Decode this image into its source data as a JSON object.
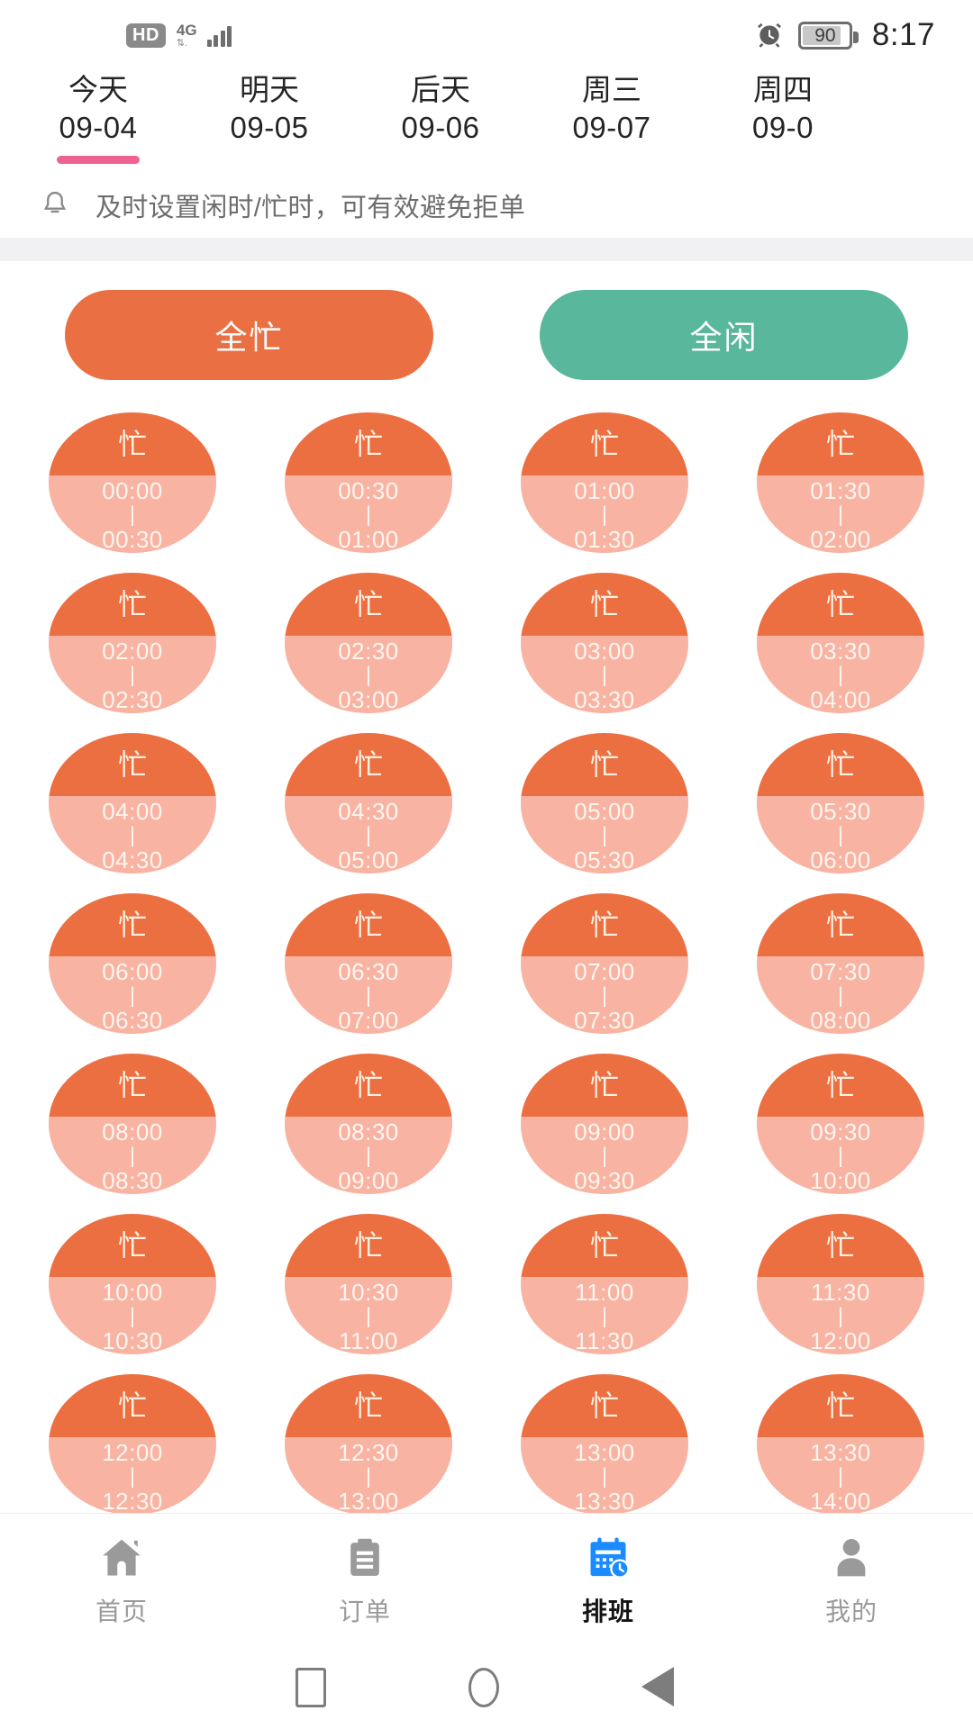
{
  "status_bar": {
    "hd_badge": "HD",
    "network_type": "4G",
    "network_sub": "↕",
    "signal_icon": "signal-bars-icon",
    "alarm_icon": "alarm-clock-icon",
    "battery_level": "90",
    "time": "8:17"
  },
  "date_tabs": [
    {
      "name": "今天",
      "date": "09-04",
      "selected": true
    },
    {
      "name": "明天",
      "date": "09-05",
      "selected": false
    },
    {
      "name": "后天",
      "date": "09-06",
      "selected": false
    },
    {
      "name": "周三",
      "date": "09-07",
      "selected": false
    },
    {
      "name": "周四",
      "date": "09-0",
      "selected": false
    }
  ],
  "tip": {
    "icon": "bell-icon",
    "text": "及时设置闲时/忙时，可有效避免拒单"
  },
  "actions": {
    "all_busy_label": "全忙",
    "all_free_label": "全闲",
    "busy_color": "#ea7044",
    "free_color": "#59b79b"
  },
  "slot_status_label": "忙",
  "slot_colors": {
    "busy_top": "#ec6f41",
    "busy_bottom": "#f9b3a3",
    "text": "#fdf6ef"
  },
  "slots": [
    {
      "status": "忙",
      "start": "00:00",
      "end": "00:30"
    },
    {
      "status": "忙",
      "start": "00:30",
      "end": "01:00"
    },
    {
      "status": "忙",
      "start": "01:00",
      "end": "01:30"
    },
    {
      "status": "忙",
      "start": "01:30",
      "end": "02:00"
    },
    {
      "status": "忙",
      "start": "02:00",
      "end": "02:30"
    },
    {
      "status": "忙",
      "start": "02:30",
      "end": "03:00"
    },
    {
      "status": "忙",
      "start": "03:00",
      "end": "03:30"
    },
    {
      "status": "忙",
      "start": "03:30",
      "end": "04:00"
    },
    {
      "status": "忙",
      "start": "04:00",
      "end": "04:30"
    },
    {
      "status": "忙",
      "start": "04:30",
      "end": "05:00"
    },
    {
      "status": "忙",
      "start": "05:00",
      "end": "05:30"
    },
    {
      "status": "忙",
      "start": "05:30",
      "end": "06:00"
    },
    {
      "status": "忙",
      "start": "06:00",
      "end": "06:30"
    },
    {
      "status": "忙",
      "start": "06:30",
      "end": "07:00"
    },
    {
      "status": "忙",
      "start": "07:00",
      "end": "07:30"
    },
    {
      "status": "忙",
      "start": "07:30",
      "end": "08:00"
    },
    {
      "status": "忙",
      "start": "08:00",
      "end": "08:30"
    },
    {
      "status": "忙",
      "start": "08:30",
      "end": "09:00"
    },
    {
      "status": "忙",
      "start": "09:00",
      "end": "09:30"
    },
    {
      "status": "忙",
      "start": "09:30",
      "end": "10:00"
    },
    {
      "status": "忙",
      "start": "10:00",
      "end": "10:30"
    },
    {
      "status": "忙",
      "start": "10:30",
      "end": "11:00"
    },
    {
      "status": "忙",
      "start": "11:00",
      "end": "11:30"
    },
    {
      "status": "忙",
      "start": "11:30",
      "end": "12:00"
    },
    {
      "status": "忙",
      "start": "12:00",
      "end": "12:30"
    },
    {
      "status": "忙",
      "start": "12:30",
      "end": "13:00"
    },
    {
      "status": "忙",
      "start": "13:00",
      "end": "13:30"
    },
    {
      "status": "忙",
      "start": "13:30",
      "end": "14:00"
    }
  ],
  "separator_divider": "|",
  "tab_bar": [
    {
      "label": "首页",
      "icon": "home-icon",
      "active": false
    },
    {
      "label": "订单",
      "icon": "clipboard-icon",
      "active": false
    },
    {
      "label": "排班",
      "icon": "calendar-clock-icon",
      "active": true
    },
    {
      "label": "我的",
      "icon": "person-icon",
      "active": false
    }
  ],
  "tab_bar_active_color": "#1a8cff",
  "android_nav": [
    {
      "name": "recents-button",
      "glyph": "square"
    },
    {
      "name": "home-button",
      "glyph": "circle"
    },
    {
      "name": "back-button",
      "glyph": "triangle"
    }
  ]
}
